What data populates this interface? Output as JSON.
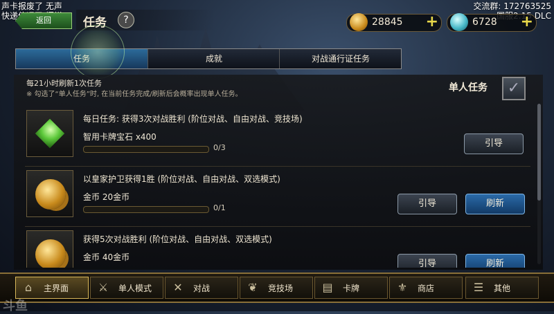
{
  "overlay": {
    "top_left_line1": "声卡报废了 无声",
    "top_left_line2": "快递停运了 摆烂",
    "top_right_line1": "交流群: 172763525",
    "top_right_line2": "国服2.15 DLC",
    "watermark": "斗鱼"
  },
  "header": {
    "back_label": "返回",
    "title": "任务",
    "help": "?",
    "gold": "28845",
    "gems": "6728",
    "plus": "+"
  },
  "tabs": [
    "任务",
    "成就",
    "对战通行证任务"
  ],
  "panel": {
    "refresh_note": "每21小时刷新1次任务",
    "single_note": "※ 勾选了“单人任务”时, 在当前任务完成/刷新后会概率出现单人任务。",
    "single_label": "单人任务",
    "checkbox_mark": "✓"
  },
  "quests": [
    {
      "title": "每日任务: 获得3次对战胜利 (阶位对战、自由对战、竞技场)",
      "reward": "智用卡牌宝石 x400",
      "progress": "0/3",
      "progress_fraction": 0,
      "buttons": [
        "引导"
      ]
    },
    {
      "title": "以皇家护卫获得1胜 (阶位对战、自由对战、双选模式)",
      "reward": "金币 20金币",
      "progress": "0/1",
      "progress_fraction": 0,
      "buttons": [
        "引导",
        "刷新"
      ]
    },
    {
      "title": "获得5次对战胜利 (阶位对战、自由对战、双选模式)",
      "reward": "金币 40金币",
      "progress": "",
      "progress_fraction": 0,
      "buttons": [
        "引导",
        "刷新"
      ]
    }
  ],
  "nav": [
    "主界面",
    "单人模式",
    "对战",
    "竞技场",
    "卡牌",
    "商店",
    "其他"
  ],
  "nav_icons": [
    "home-icon",
    "sword-icon",
    "crossed-swords-icon",
    "laurel-icon",
    "cards-icon",
    "shop-icon",
    "more-icon"
  ]
}
